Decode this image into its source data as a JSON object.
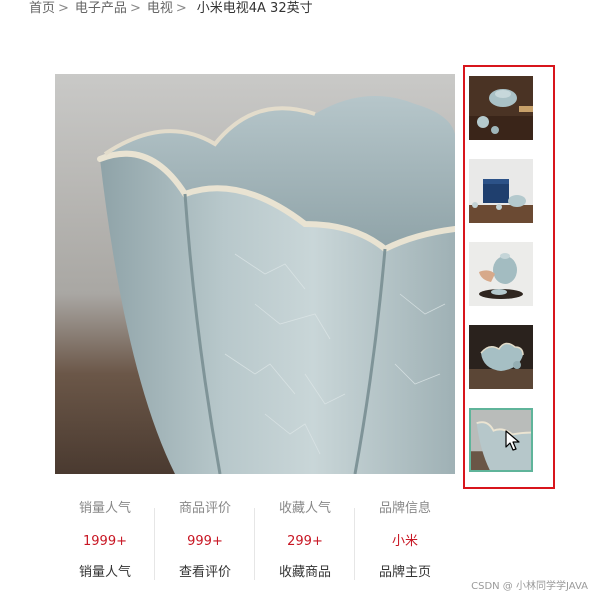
{
  "breadcrumb": {
    "items": [
      "首页",
      "电子产品",
      "电视"
    ],
    "separator": ">",
    "current": "小米电视4A 32英寸"
  },
  "gallery": {
    "main_image": "celadon-flower-bowl-closeup",
    "thumbnails": [
      {
        "image": "celadon-teacups-on-wood"
      },
      {
        "image": "tea-set-gift-box"
      },
      {
        "image": "hand-pouring-teapot"
      },
      {
        "image": "flower-bowl-dark-background"
      },
      {
        "image": "celadon-flower-bowl-closeup",
        "active": true
      }
    ],
    "highlight_color": "#d8151c",
    "active_border_color": "#5fb49a"
  },
  "stats": [
    {
      "label": "销量人气",
      "value": "1999+",
      "action": "销量人气"
    },
    {
      "label": "商品评价",
      "value": "999+",
      "action": "查看评价"
    },
    {
      "label": "收藏人气",
      "value": "299+",
      "action": "收藏商品"
    },
    {
      "label": "品牌信息",
      "value": "小米",
      "action": "品牌主页"
    }
  ],
  "accent_color": "#c81623",
  "watermark": "CSDN @ 小林同学学JAVA"
}
